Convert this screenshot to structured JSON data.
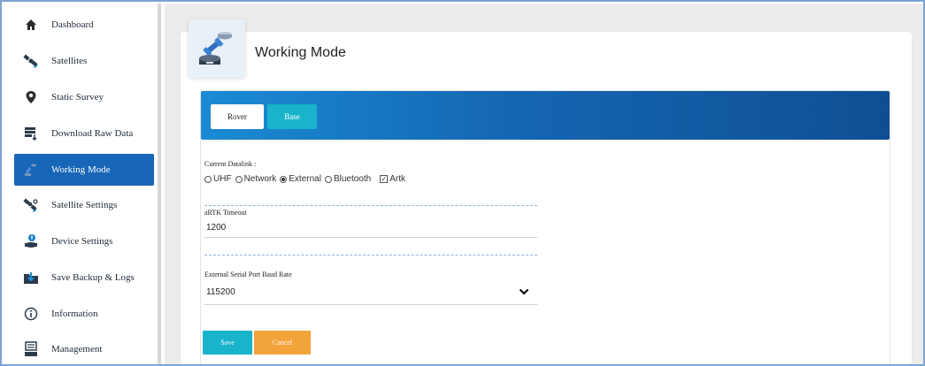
{
  "sidebar": {
    "items": [
      {
        "label": "Dashboard",
        "icon": "home-icon"
      },
      {
        "label": "Satellites",
        "icon": "satellite-icon"
      },
      {
        "label": "Static Survey",
        "icon": "map-pin-icon"
      },
      {
        "label": "Download Raw Data",
        "icon": "download-data-icon"
      },
      {
        "label": "Working Mode",
        "icon": "working-mode-icon",
        "active": true
      },
      {
        "label": "Satellite Settings",
        "icon": "satellite-settings-icon"
      },
      {
        "label": "Device Settings",
        "icon": "device-settings-icon"
      },
      {
        "label": "Save Backup & Logs",
        "icon": "backup-logs-icon"
      },
      {
        "label": "Information",
        "icon": "info-icon"
      },
      {
        "label": "Management",
        "icon": "management-icon"
      }
    ]
  },
  "page": {
    "title": "Working Mode",
    "title_icon": "working-mode-icon"
  },
  "tabs": {
    "rover": "Rover",
    "base": "Base",
    "active": "rover"
  },
  "form": {
    "datalink_label": "Current Datalink :",
    "datalink_options": [
      "UHF",
      "Network",
      "External",
      "Bluetooth"
    ],
    "datalink_selected": "External",
    "artk_label": "Artk",
    "artk_checked": true,
    "artk_timeout_label": "aRTK Timeout",
    "artk_timeout_value": "1200",
    "baud_label": "External Serial Port Baud Rate",
    "baud_value": "115200",
    "save_label": "Save",
    "cancel_label": "Cancel"
  },
  "colors": {
    "accent_blue": "#1866b7",
    "teal": "#19b3cb",
    "orange": "#f2a33a"
  }
}
